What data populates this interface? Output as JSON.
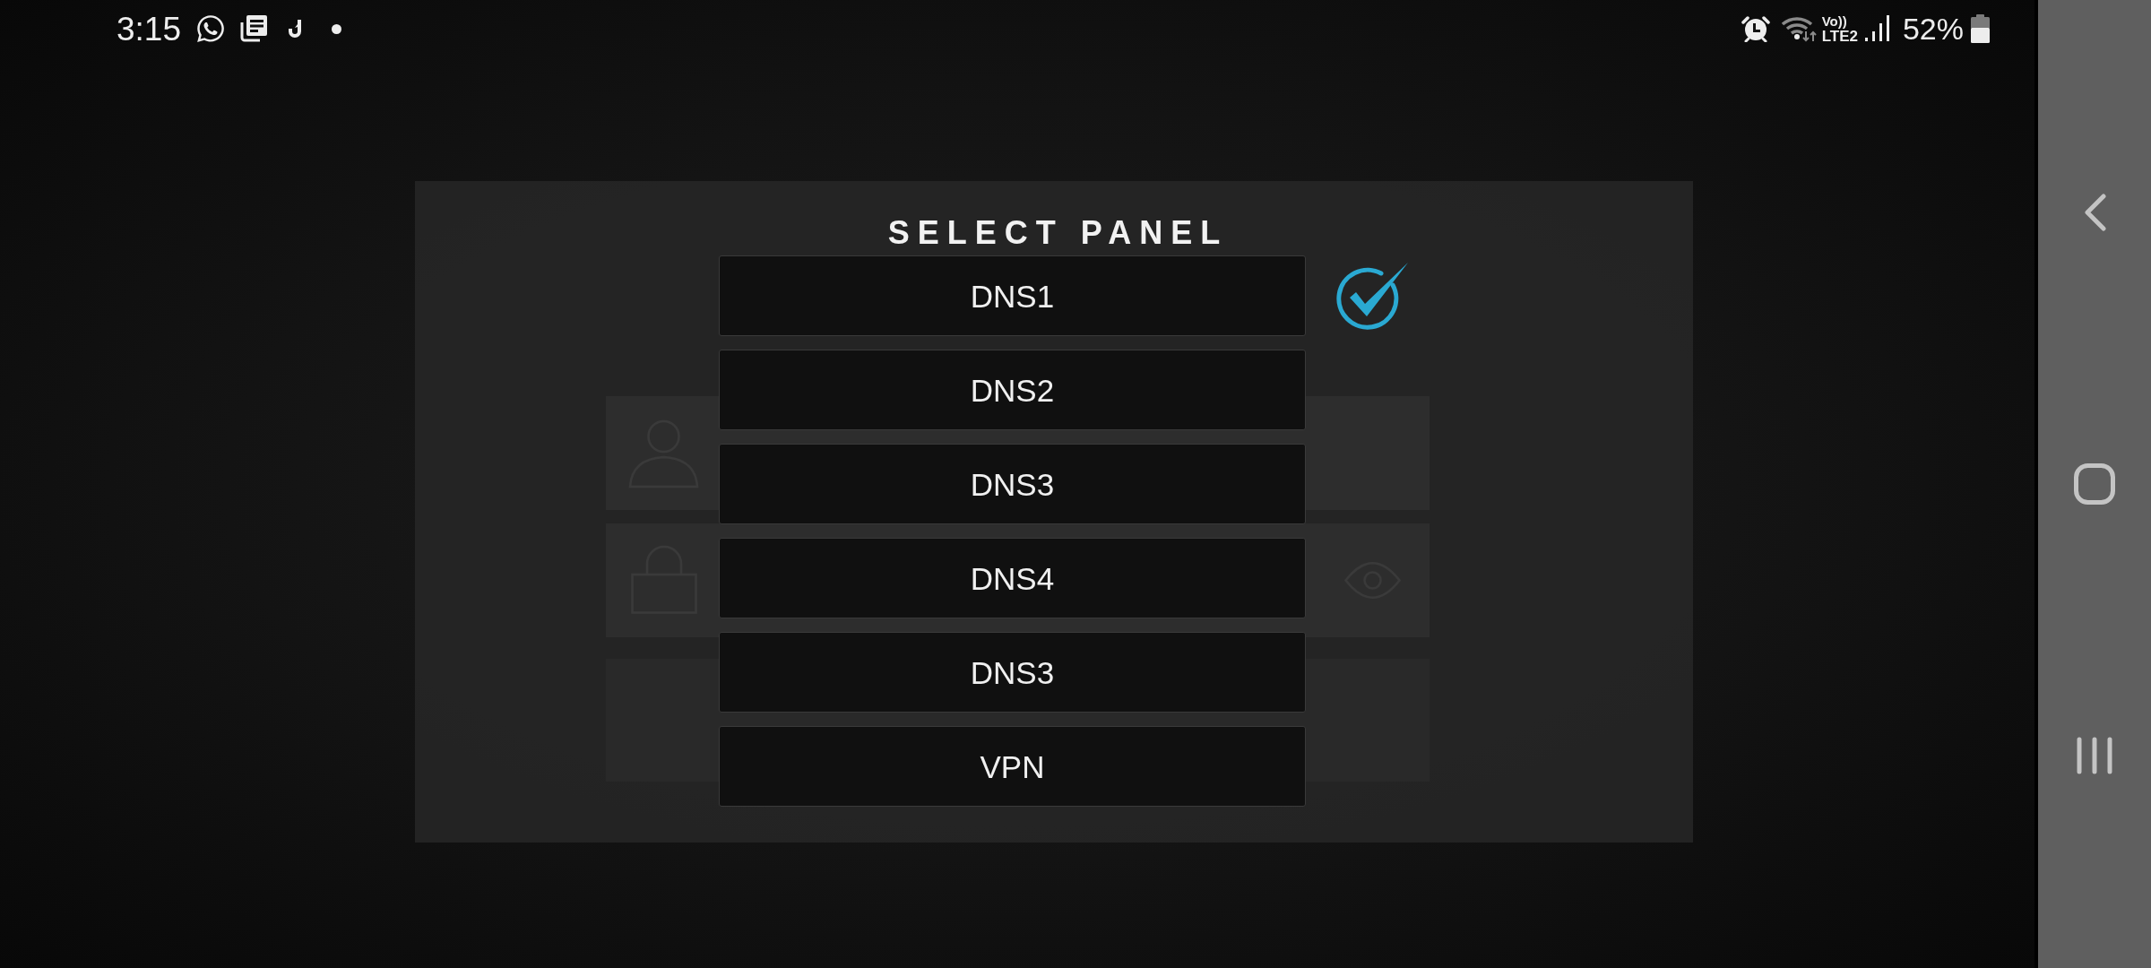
{
  "status_bar": {
    "time": "3:15",
    "volte": "Vo))",
    "network": "LTE2",
    "battery": "52%"
  },
  "dialog": {
    "title": "SELECT PANEL",
    "options": [
      {
        "label": "DNS1",
        "selected": true
      },
      {
        "label": "DNS2",
        "selected": false
      },
      {
        "label": "DNS3",
        "selected": false
      },
      {
        "label": "DNS4",
        "selected": false
      },
      {
        "label": "DNS3",
        "selected": false
      },
      {
        "label": "VPN",
        "selected": false
      }
    ]
  }
}
